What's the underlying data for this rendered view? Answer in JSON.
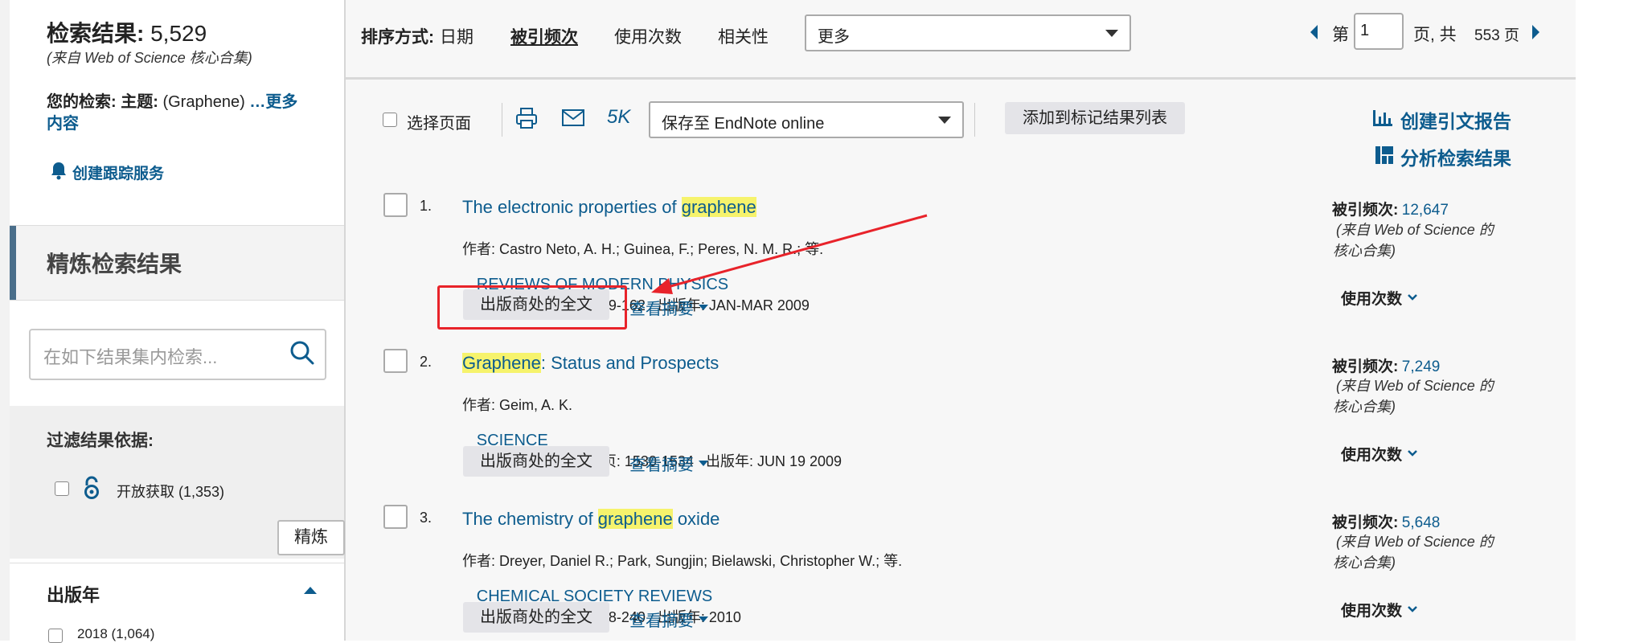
{
  "left": {
    "results_label": "检索结果:",
    "results_count": "5,529",
    "results_source": "(来自 Web of Science 核心合集)",
    "your_search_label": "您的检索:",
    "topic_label": "主题:",
    "topic_value": "(Graphene)",
    "more_link": "…更多",
    "more_link_line2": "内容",
    "alert_label": "创建跟踪服务",
    "refine_title": "精炼检索结果",
    "search_placeholder": "在如下结果集内检索...",
    "filter_title": "过滤结果依据:",
    "open_access": "开放获取 (1,353)",
    "refine_button": "精炼",
    "year_title": "出版年",
    "year_item": "2018 (1,064)"
  },
  "topbar": {
    "sort_label": "排序方式:",
    "sort_options": [
      "日期",
      "被引频次",
      "使用次数",
      "相关性"
    ],
    "more_select": "更多",
    "page_prefix": "第",
    "page_value": "1",
    "page_suffix": "页, 共",
    "page_total": "553 页"
  },
  "toolbar": {
    "select_page": "选择页面",
    "count_5k": "5K",
    "save_select": "保存至 EndNote online",
    "add_to_marked": "添加到标记结果列表",
    "citation_report": "创建引文报告",
    "analyze_results": "分析检索结果"
  },
  "records": [
    {
      "num": "1.",
      "title_pre": "The electronic properties of ",
      "title_hl": "graphene",
      "title_post": "",
      "authors": "作者: Castro Neto, A. H.; Guinea, F.; Peres, N. M. R.; 等.",
      "source": "REVIEWS OF MODERN PHYSICS",
      "details": "卷: 81   期: 1   页: 109-162   出版年: JAN-MAR 2009",
      "fulltext": "出版商处的全文",
      "abstract": "查看摘要",
      "cite_label": "被引频次:",
      "cite_value": "12,647",
      "cite_note1": "(来自 Web of Science 的",
      "cite_note2": "核心合集)",
      "usage": "使用次数"
    },
    {
      "num": "2.",
      "title_pre": "",
      "title_hl": "Graphene",
      "title_post": ": Status and Prospects",
      "authors": "作者: Geim, A. K.",
      "source": "SCIENCE",
      "details": "卷: 324   期: 5934   页: 1530-1534   出版年: JUN 19 2009",
      "fulltext": "出版商处的全文",
      "abstract": "查看摘要",
      "cite_label": "被引频次:",
      "cite_value": "7,249",
      "cite_note1": "(来自 Web of Science 的",
      "cite_note2": "核心合集)",
      "usage": "使用次数"
    },
    {
      "num": "3.",
      "title_pre": "The chemistry of ",
      "title_hl": "graphene",
      "title_post": " oxide",
      "authors": "作者: Dreyer, Daniel R.; Park, Sungjin; Bielawski, Christopher W.; 等.",
      "source": "CHEMICAL SOCIETY REVIEWS",
      "details": "卷: 39   期: 1   页: 228-240   出版年: 2010",
      "fulltext": "出版商处的全文",
      "abstract": "查看摘要",
      "cite_label": "被引频次:",
      "cite_value": "5,648",
      "cite_note1": "(来自 Web of Science 的",
      "cite_note2": "核心合集)",
      "usage": "使用次数"
    }
  ],
  "colors": {
    "link": "#0d5c8e",
    "highlight": "#f6f36c",
    "annotation_red": "#e8232a",
    "refine_bar": "#4a6e8a"
  }
}
